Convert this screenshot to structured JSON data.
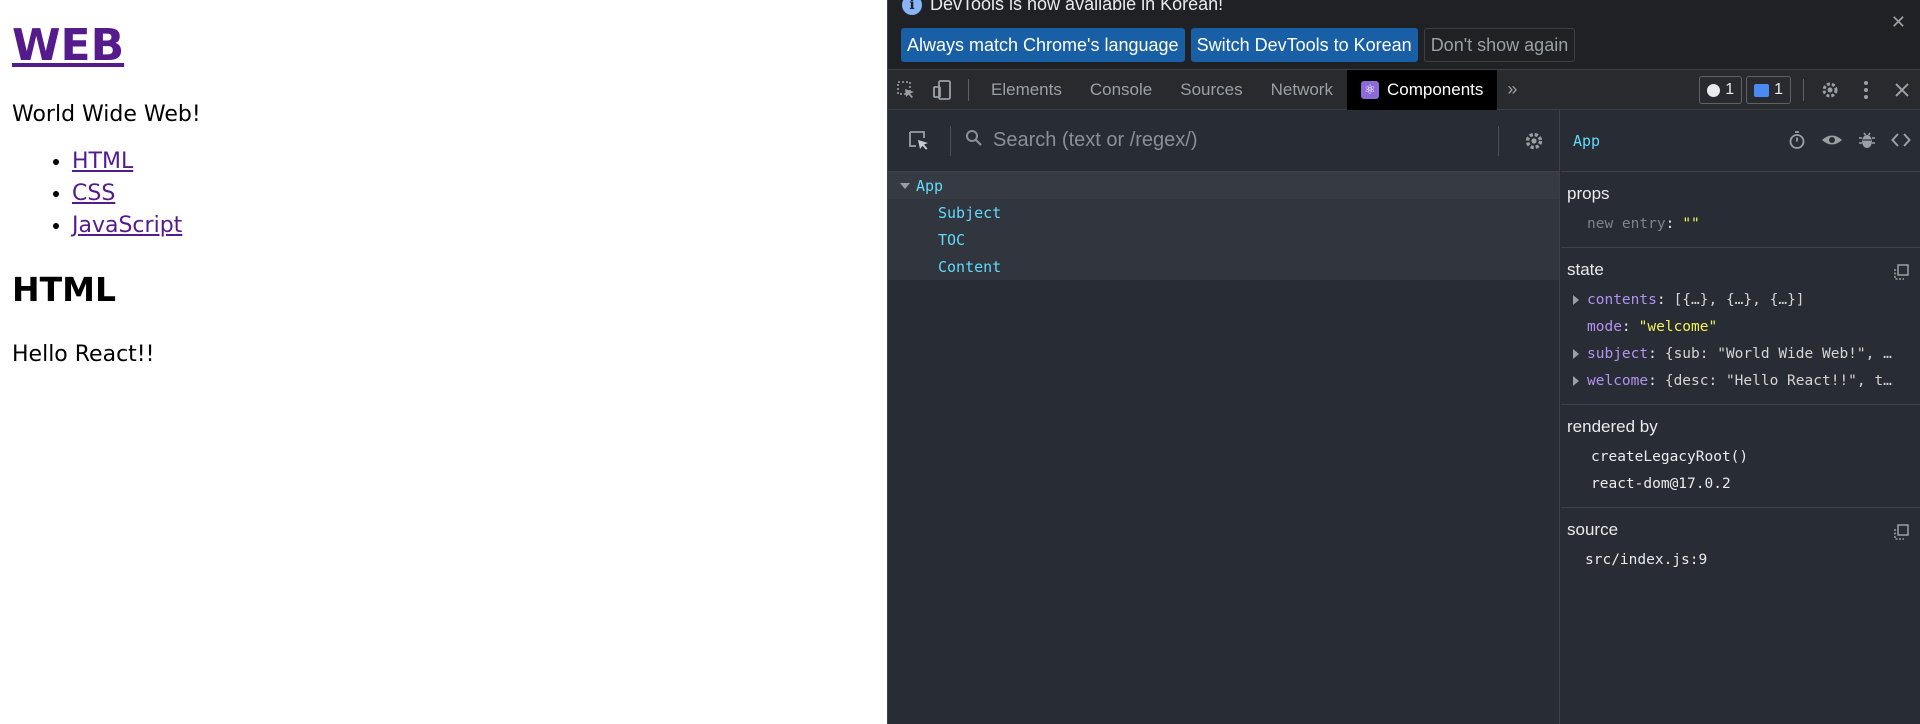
{
  "page": {
    "heading": "WEB",
    "subtitle": "World Wide Web!",
    "nav_links": [
      "HTML",
      "CSS",
      "JavaScript"
    ],
    "content_title": "HTML",
    "content_desc": "Hello React!!"
  },
  "devtools": {
    "infobar": {
      "message": "DevTools is now available in Korean!",
      "buttons": [
        "Always match Chrome's language",
        "Switch DevTools to Korean",
        "Don't show again"
      ]
    },
    "tabs": [
      "Elements",
      "Console",
      "Sources",
      "Network",
      "Components"
    ],
    "active_tab": "Components",
    "counters": {
      "issues": "1",
      "messages": "1"
    },
    "tree": {
      "search_placeholder": "Search (text or /regex/)",
      "root": "App",
      "children": [
        "Subject",
        "TOC",
        "Content"
      ]
    },
    "inspector": {
      "component_name": "App",
      "props_title": "props",
      "props": [
        {
          "key": "new entry",
          "value": "\"\""
        }
      ],
      "state_title": "state",
      "state": [
        {
          "key": "contents",
          "value": "[{…}, {…}, {…}]",
          "expandable": true
        },
        {
          "key": "mode",
          "value": "\"welcome\"",
          "expandable": false
        },
        {
          "key": "subject",
          "value": "{sub: \"World Wide Web!\", …",
          "expandable": true
        },
        {
          "key": "welcome",
          "value": "{desc: \"Hello React!!\", t…",
          "expandable": true
        }
      ],
      "rendered_by_title": "rendered by",
      "rendered_by": [
        "createLegacyRoot()",
        "react-dom@17.0.2"
      ],
      "source_title": "source",
      "source": "src/index.js:9"
    }
  },
  "colors": {
    "link_visited": "#551a8b",
    "react_blue": "#61dafb",
    "devtools_bg": "#282c34",
    "button_blue": "#185fa6"
  }
}
